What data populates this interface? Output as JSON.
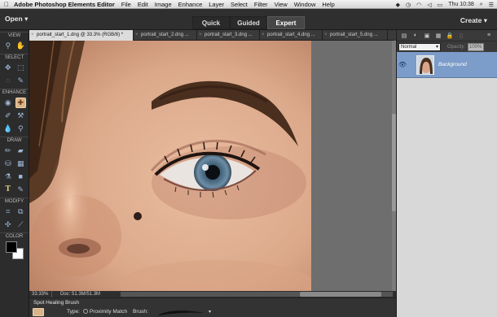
{
  "menubar": {
    "app_name": "Adobe Photoshop Elements Editor",
    "menus": [
      "File",
      "Edit",
      "Image",
      "Enhance",
      "Layer",
      "Select",
      "Filter",
      "View",
      "Window",
      "Help"
    ],
    "clock": "Thu 10:38"
  },
  "modebar": {
    "open_label": "Open",
    "modes": [
      "Quick",
      "Guided",
      "Expert"
    ],
    "active_mode": "Expert",
    "create_label": "Create"
  },
  "toolbox": {
    "sections": [
      "VIEW",
      "SELECT",
      "ENHANCE",
      "DRAW",
      "MODIFY",
      "COLOR"
    ],
    "foreground_color": "#000000",
    "background_color": "#ffffff"
  },
  "tabs": [
    {
      "label": "portrait_start_1.dng @ 33.3% (RGB/8) *",
      "active": true
    },
    {
      "label": "portrait_start_2.dng ...",
      "active": false
    },
    {
      "label": "portrait_start_3.dng ...",
      "active": false
    },
    {
      "label": "portrait_start_4.dng ...",
      "active": false
    },
    {
      "label": "portrait_start_5.dng ...",
      "active": false
    }
  ],
  "status": {
    "zoom": "33.33%",
    "doc": "Doc: 51.3M/51.3M"
  },
  "tool_options": {
    "tool_name": "Spot Healing Brush",
    "type_label": "Type:",
    "type_value": "Proximity Match",
    "brush_label": "Brush:"
  },
  "layers_panel": {
    "blend_mode": "Normal",
    "opacity_label": "Opacity:",
    "opacity_value": "100%",
    "layers": [
      {
        "name": "Background"
      }
    ]
  }
}
